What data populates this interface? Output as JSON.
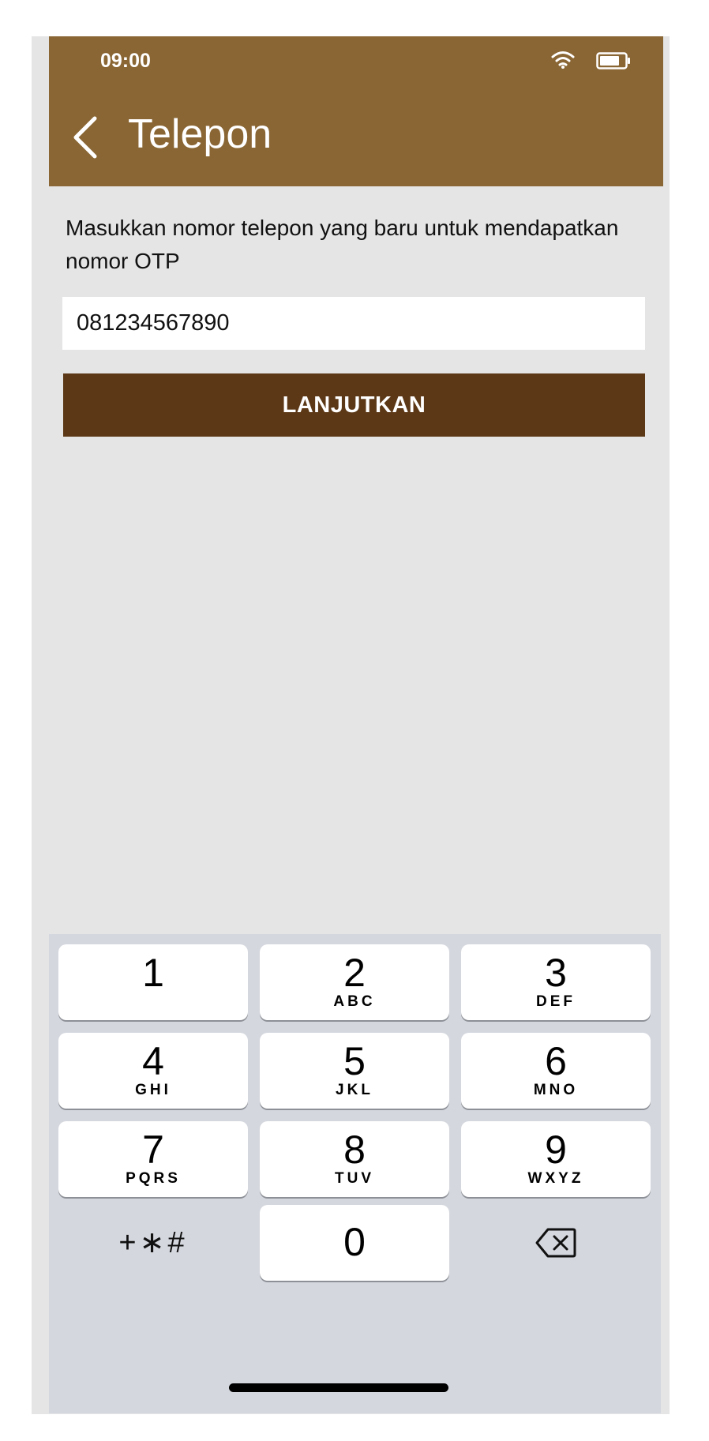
{
  "status_bar": {
    "time": "09:00"
  },
  "header": {
    "title": "Telepon"
  },
  "instruction": "Masukkan nomor telepon yang baru untuk mendapatkan nomor OTP",
  "phone_field": {
    "value": "081234567890"
  },
  "continue_button": {
    "label": "LANJUTKAN"
  },
  "keypad": {
    "keys": [
      {
        "digit": "1",
        "letters": ""
      },
      {
        "digit": "2",
        "letters": "ABC"
      },
      {
        "digit": "3",
        "letters": "DEF"
      },
      {
        "digit": "4",
        "letters": "GHI"
      },
      {
        "digit": "5",
        "letters": "JKL"
      },
      {
        "digit": "6",
        "letters": "MNO"
      },
      {
        "digit": "7",
        "letters": "PQRS"
      },
      {
        "digit": "8",
        "letters": "TUV"
      },
      {
        "digit": "9",
        "letters": "WXYZ"
      }
    ],
    "symbols": "+∗#",
    "zero": "0"
  },
  "colors": {
    "header": "#8a6634",
    "button": "#5c3816",
    "background": "#e5e5e6",
    "keypad": "#d4d7de"
  },
  "icons": {
    "back": "chevron-left-icon",
    "wifi": "wifi-icon",
    "battery": "battery-icon",
    "delete": "backspace-icon"
  }
}
